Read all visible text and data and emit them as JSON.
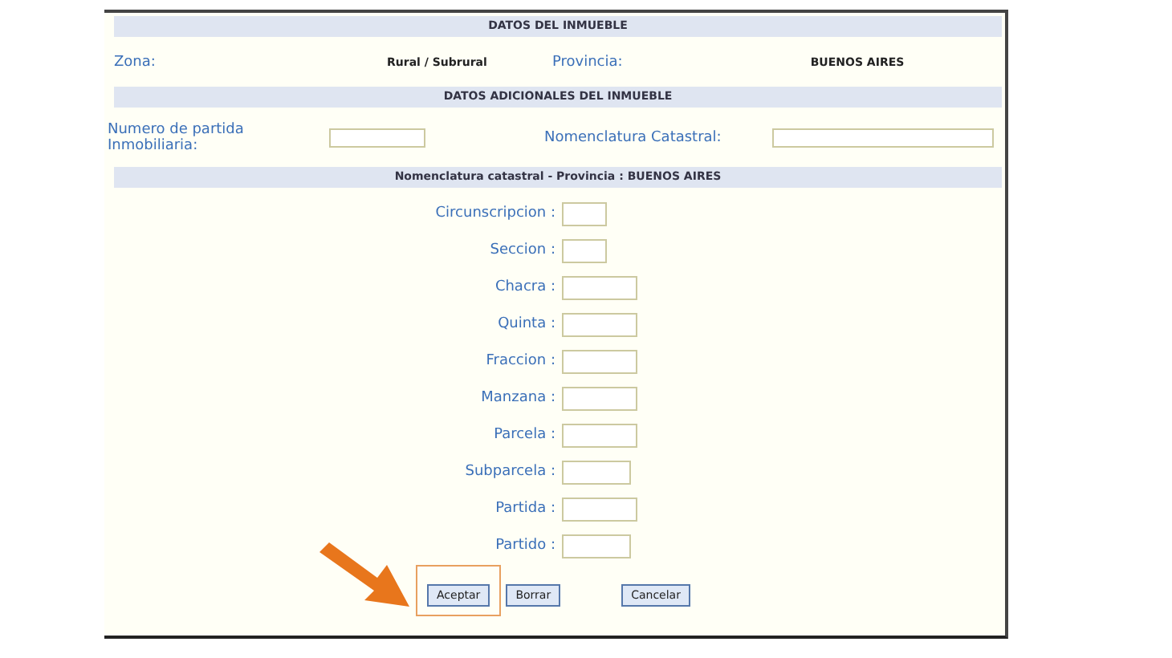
{
  "sections": [
    {
      "title": "DATOS DEL INMUEBLE"
    },
    {
      "title": "DATOS ADICIONALES DEL INMUEBLE"
    },
    {
      "title": "Nomenclatura catastral - Provincia : BUENOS AIRES"
    }
  ],
  "zona": {
    "label": "Zona:",
    "value": "Rural / Subrural"
  },
  "provincia": {
    "label": "Provincia:",
    "value": "BUENOS AIRES"
  },
  "partida": {
    "label": "Numero de partida Inmobiliaria:"
  },
  "nomenclatura": {
    "label": "Nomenclatura Catastral:"
  },
  "fields": [
    {
      "label": "Circunscripcion :"
    },
    {
      "label": "Seccion :"
    },
    {
      "label": "Chacra :"
    },
    {
      "label": "Quinta :"
    },
    {
      "label": "Fraccion :"
    },
    {
      "label": "Manzana :"
    },
    {
      "label": "Parcela :"
    },
    {
      "label": "Subparcela :"
    },
    {
      "label": "Partida :"
    },
    {
      "label": "Partido :"
    }
  ],
  "buttons": [
    {
      "label": "Aceptar",
      "highlighted": true
    },
    {
      "label": "Borrar",
      "highlighted": false
    },
    {
      "label": "Cancelar",
      "highlighted": false
    }
  ]
}
